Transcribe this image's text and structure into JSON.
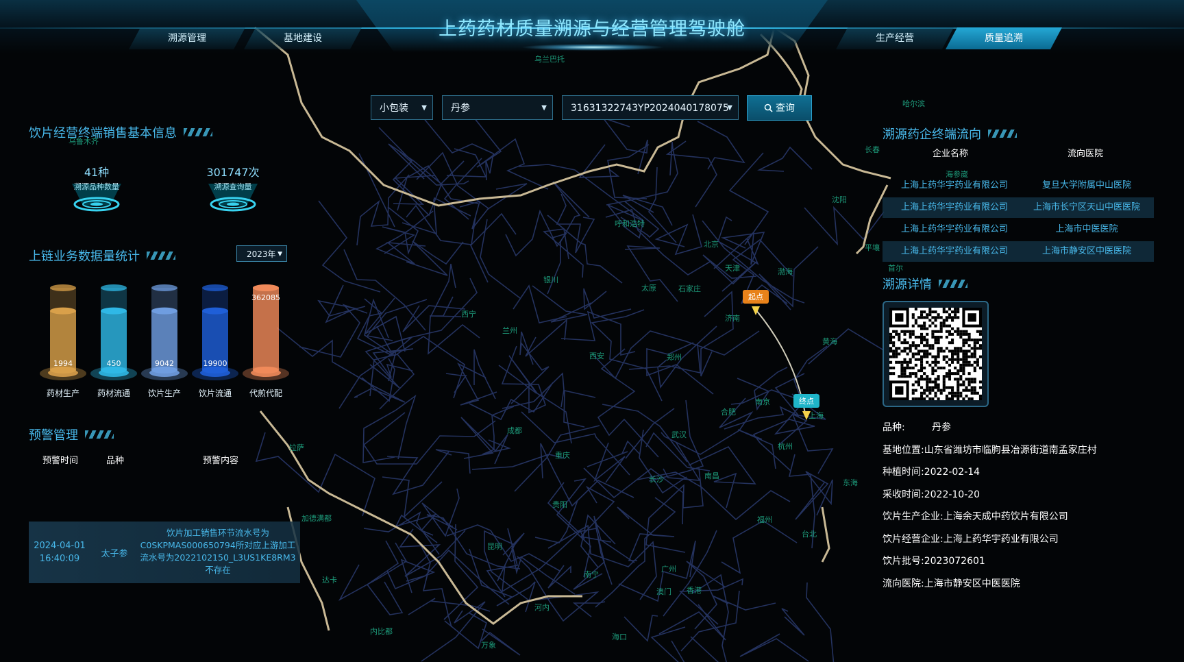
{
  "header": {
    "title": "上药药材质量溯源与经营管理驾驶舱",
    "tabs": [
      {
        "label": "溯源管理",
        "active": false
      },
      {
        "label": "基地建设",
        "active": false
      },
      {
        "label": "生产经营",
        "active": false
      },
      {
        "label": "质量追溯",
        "active": true
      }
    ]
  },
  "search": {
    "package": "小包装",
    "herb": "丹参",
    "code": "31631322743YP2024040178075",
    "query_label": "查询"
  },
  "left": {
    "sales_title": "饮片经营终端销售基本信息",
    "stats": [
      {
        "value": "41种",
        "label": "溯源品种数量"
      },
      {
        "value": "301747次",
        "label": "溯源查询量"
      }
    ],
    "chain_title": "上链业务数据量统计",
    "year": "2023年",
    "warn_title": "预警管理",
    "warn_headers": [
      "预警时间",
      "品种",
      "预警内容"
    ],
    "warnings": [
      {
        "date": "2024-04-01",
        "time": "16:40:09",
        "kind": "太子参",
        "content": "饮片加工销售环节流水号为C0SKPMAS000650794所对应上游加工流水号为2022102150_L3US1KE8RM3不存在"
      }
    ]
  },
  "chart_data": {
    "type": "bar",
    "categories": [
      "药材生产",
      "药材流通",
      "饮片生产",
      "饮片流通",
      "代煎代配"
    ],
    "values": [
      1994,
      450,
      9042,
      19900,
      362085
    ],
    "colors": [
      "#d9a04a",
      "#2fb8e6",
      "#6f9de0",
      "#1f5fd8",
      "#f08a5a"
    ]
  },
  "right": {
    "flow_title": "溯源药企终端流向",
    "flow_headers": [
      "企业名称",
      "流向医院"
    ],
    "flow_rows": [
      {
        "company": "上海上药华宇药业有限公司",
        "hospital": "复旦大学附属中山医院"
      },
      {
        "company": "上海上药华宇药业有限公司",
        "hospital": "上海市长宁区天山中医医院"
      },
      {
        "company": "上海上药华宇药业有限公司",
        "hospital": "上海市中医医院"
      },
      {
        "company": "上海上药华宇药业有限公司",
        "hospital": "上海市静安区中医医院"
      }
    ],
    "detail_title": "溯源详情",
    "details": [
      {
        "label": "品种:",
        "value": "丹参"
      },
      {
        "label": "基地位置:",
        "value": "山东省潍坊市临朐县冶源街道南孟家庄村"
      },
      {
        "label": "种植时间:",
        "value": "2022-02-14"
      },
      {
        "label": "采收时间:",
        "value": "2022-10-20"
      },
      {
        "label": "饮片生产企业:",
        "value": "上海余天成中药饮片有限公司"
      },
      {
        "label": "饮片经营企业:",
        "value": "上海上药华宇药业有限公司"
      },
      {
        "label": "饮片批号:",
        "value": "2023072601"
      },
      {
        "label": "流向医院:",
        "value": "上海市静安区中医医院"
      }
    ]
  },
  "map": {
    "start_label": "起点",
    "end_label": "终点",
    "cities": [
      "呼和浩特",
      "北京",
      "天津",
      "石家庄",
      "太原",
      "银川",
      "济南",
      "西宁",
      "兰州",
      "西安",
      "郑州",
      "合肥",
      "南京",
      "上海",
      "杭州",
      "武汉",
      "成都",
      "重庆",
      "长沙",
      "南昌",
      "贵阳",
      "昆明",
      "福州",
      "台北",
      "广州",
      "南宁",
      "香港",
      "澳门",
      "海口",
      "拉萨",
      "沈阳",
      "长春",
      "哈尔滨",
      "渤海",
      "黄海",
      "东海",
      "河内",
      "万象",
      "内比都",
      "达卡",
      "加德满都",
      "平壤",
      "首尔",
      "海参崴",
      "乌兰巴托",
      "乌鲁木齐"
    ]
  }
}
